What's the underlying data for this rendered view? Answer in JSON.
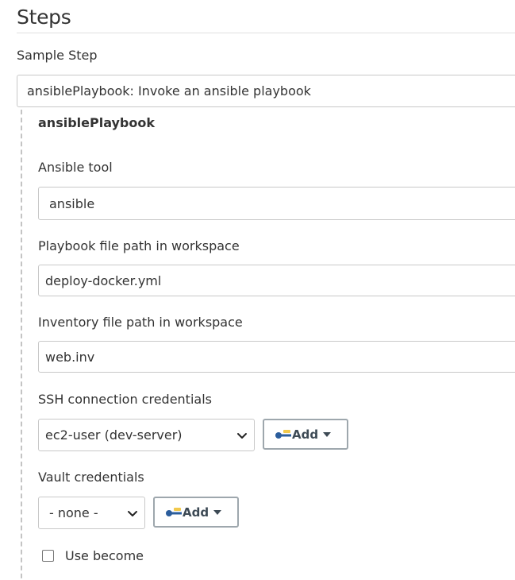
{
  "section": {
    "title": "Steps"
  },
  "sample_step": {
    "label": "Sample Step",
    "selected": "ansiblePlaybook: Invoke an ansible playbook"
  },
  "step_form": {
    "title": "ansiblePlaybook",
    "ansible_tool": {
      "label": "Ansible tool",
      "value": "ansible"
    },
    "playbook": {
      "label": "Playbook file path in workspace",
      "value": "deploy-docker.yml"
    },
    "inventory": {
      "label": "Inventory file path in workspace",
      "value": "web.inv"
    },
    "ssh_credentials": {
      "label": "SSH connection credentials",
      "selected": "ec2-user (dev-server)",
      "add_label": "Add"
    },
    "vault_credentials": {
      "label": "Vault credentials",
      "selected": "- none -",
      "add_label": "Add"
    },
    "use_become": {
      "label": "Use become",
      "checked": false
    }
  },
  "icons": {
    "add_button_icon": "key-icon",
    "select_icon": "chevron-down-icon",
    "add_dropdown_icon": "caret-down-icon"
  },
  "colors": {
    "key_icon_blue": "#2b5d9c",
    "key_icon_yellow": "#f2c94c"
  }
}
